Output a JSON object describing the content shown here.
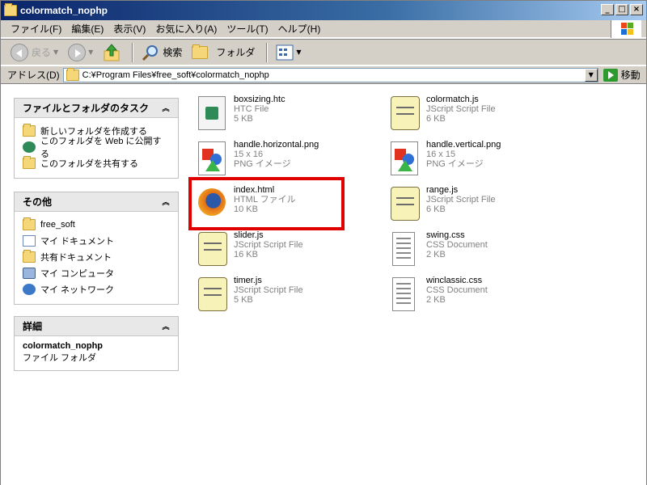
{
  "window": {
    "title": "colormatch_nophp"
  },
  "window_buttons": {
    "minimize": "_",
    "maximize": "□",
    "close": "×"
  },
  "menu": [
    "ファイル(F)",
    "編集(E)",
    "表示(V)",
    "お気に入り(A)",
    "ツール(T)",
    "ヘルプ(H)"
  ],
  "toolbar": {
    "back_label": "戻る",
    "search_label": "検索",
    "folder_label": "フォルダ"
  },
  "address": {
    "label": "アドレス(D)",
    "value": "C:¥Program Files¥free_soft¥colormatch_nophp",
    "go_label": "移動"
  },
  "tasks": {
    "title": "ファイルとフォルダのタスク",
    "items": [
      "新しいフォルダを作成する",
      "このフォルダを Web に公開する",
      "このフォルダを共有する"
    ]
  },
  "other": {
    "title": "その他",
    "items": [
      "free_soft",
      "マイ ドキュメント",
      "共有ドキュメント",
      "マイ コンピュータ",
      "マイ ネットワーク"
    ]
  },
  "details": {
    "title": "詳細",
    "name": "colormatch_nophp",
    "type": "ファイル フォルダ"
  },
  "files": [
    {
      "name": "boxsizing.htc",
      "type": "HTC File",
      "size": "5 KB",
      "icon": "htc-file-icon"
    },
    {
      "name": "colormatch.js",
      "type": "JScript Script File",
      "size": "6 KB",
      "icon": "script-file-icon"
    },
    {
      "name": "handle.horizontal.png",
      "type": "15 x 16",
      "size": "PNG イメージ",
      "icon": "png-image-icon"
    },
    {
      "name": "handle.vertical.png",
      "type": "16 x 15",
      "size": "PNG イメージ",
      "icon": "png-image-icon"
    },
    {
      "name": "index.html",
      "type": "HTML ファイル",
      "size": "10 KB",
      "icon": "firefox-html-icon"
    },
    {
      "name": "range.js",
      "type": "JScript Script File",
      "size": "6 KB",
      "icon": "script-file-icon"
    },
    {
      "name": "slider.js",
      "type": "JScript Script File",
      "size": "16 KB",
      "icon": "script-file-icon"
    },
    {
      "name": "swing.css",
      "type": "CSS Document",
      "size": "2 KB",
      "icon": "css-document-icon"
    },
    {
      "name": "timer.js",
      "type": "JScript Script File",
      "size": "5 KB",
      "icon": "script-file-icon"
    },
    {
      "name": "winclassic.css",
      "type": "CSS Document",
      "size": "2 KB",
      "icon": "css-document-icon"
    }
  ],
  "colors": {
    "highlight": "#e00000",
    "title_bar": "#0a246a"
  }
}
